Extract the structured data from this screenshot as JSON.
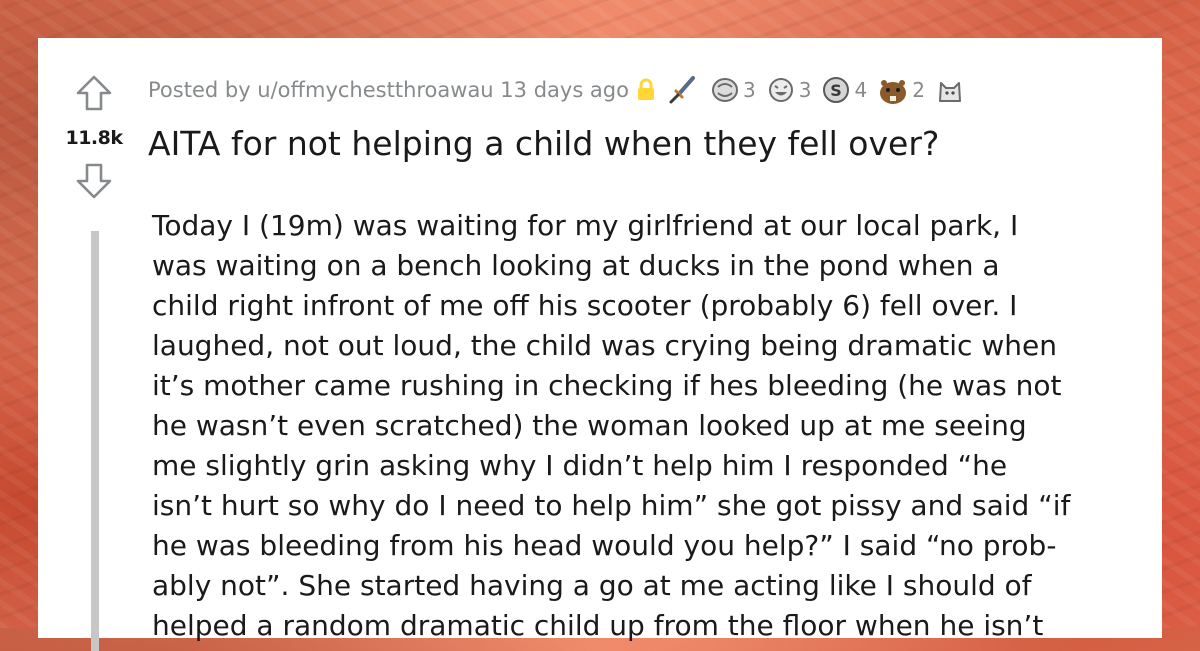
{
  "post": {
    "author_line": "Posted by u/offmychestthroawau 13 days ago",
    "awards": [
      {
        "icon": "sword-award-icon",
        "count": ""
      },
      {
        "icon": "hands-award-icon",
        "count": "3"
      },
      {
        "icon": "laughing-award-icon",
        "count": "3"
      },
      {
        "icon": "silver-coin-award-icon",
        "count": "4"
      },
      {
        "icon": "beaver-award-icon",
        "count": "2"
      },
      {
        "icon": "cat-award-icon",
        "count": ""
      }
    ],
    "score": "11.8k",
    "title": "AITA for not helping a child when they fell over?",
    "body_lines": [
      "Today I (19m) was waiting for my girlfriend at our local park, I",
      "was waiting on a bench looking at ducks in the pond when a",
      "child right infront of me off his scooter (probably 6) fell over. I",
      "laughed, not out loud, the child was crying being dramatic when",
      "it’s mother came rushing in checking if hes bleeding (he was not",
      "he wasn’t even scratched) the woman looked up at me seeing",
      "me slightly grin asking why I didn’t help him I responded “he",
      "isn’t hurt so why do I need to help him” she got pissy and said “if",
      "he was bleeding from his head would you help?” I said “no prob-",
      "ably not”. She started having a go at me acting like I should of",
      "helped a random dramatic child up from the floor when he isn’t"
    ]
  },
  "colors": {
    "meta_text": "#878a8c",
    "title_text": "#1a1a1b",
    "lock": "#ffd635",
    "thread_line": "#c7c7c7"
  }
}
